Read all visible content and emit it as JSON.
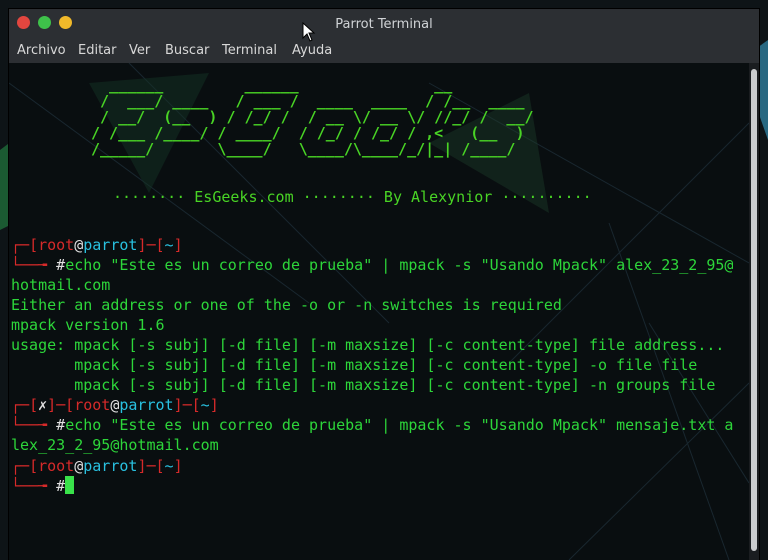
{
  "window": {
    "title": "Parrot Terminal"
  },
  "menu": [
    "Archivo",
    "Editar",
    "Ver",
    "Buscar",
    "Terminal",
    "Ayuda"
  ],
  "banner": {
    "ascii": "  ______         ______               __\n /  ___/ ____   / ___ /  ____  ____  / /__  ____\n / __/  (__  ) / /_/ /  / __ \\/ __ \\/ //_/ /  __/\n/ /___ /____/ / ____/  / /_/ / /_/ / ,<   (__  )\n/_____/       \\____/   \\____/\\____/_/|_| /____/",
    "tagline": "········ EsGeeks.com ········ By Alexynior ··········"
  },
  "prompt": {
    "corner_top": "┌─",
    "corner_bottom": "└──╼ ",
    "open": "[",
    "user": "root",
    "at": "@",
    "host": "parrot",
    "sep": "]─[",
    "dir": "~",
    "close": "]",
    "error_mark": "✗",
    "error_sep": "]─[",
    "hash": "#"
  },
  "commands": {
    "cmd1_a": "echo \"Este es un correo de prueba\" | mpack -s \"Usando Mpack\" alex_23_2_95@",
    "cmd1_b": "hotmail.com",
    "cmd2_a": "echo \"Este es un correo de prueba\" | mpack -s \"Usando Mpack\" mensaje.txt a",
    "cmd2_b": "lex_23_2_95@hotmail.com"
  },
  "output": [
    "Either an address or one of the -o or -n switches is required",
    "mpack version 1.6",
    "usage: mpack [-s subj] [-d file] [-m maxsize] [-c content-type] file address...",
    "       mpack [-s subj] [-d file] [-m maxsize] [-c content-type] -o file file",
    "       mpack [-s subj] [-d file] [-m maxsize] [-c content-type] -n groups file"
  ],
  "colors": {
    "terminal_green": "#2dd63a",
    "prompt_red": "#d62a2a",
    "prompt_cyan": "#29c1e0",
    "banner_green": "#49d425"
  }
}
